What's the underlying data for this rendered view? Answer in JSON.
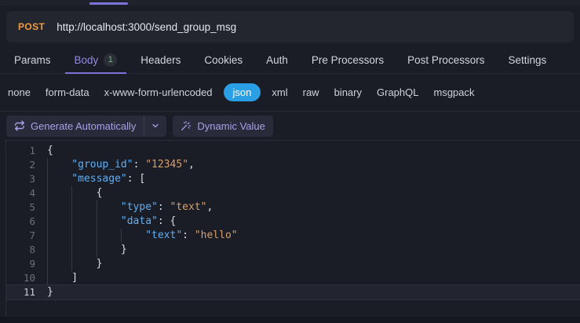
{
  "window": {
    "top_tab_indicator_color": "#7c73da"
  },
  "request_bar": {
    "method": "POST",
    "url": "http://localhost:3000/send_group_msg",
    "method_color": "#ef9b40"
  },
  "tabs": [
    {
      "label": "Params"
    },
    {
      "label": "Body",
      "badge": "1",
      "active": true
    },
    {
      "label": "Headers"
    },
    {
      "label": "Cookies"
    },
    {
      "label": "Auth"
    },
    {
      "label": "Pre Processors"
    },
    {
      "label": "Post Processors"
    },
    {
      "label": "Settings"
    }
  ],
  "body_types": [
    {
      "label": "none"
    },
    {
      "label": "form-data"
    },
    {
      "label": "x-www-form-urlencoded"
    },
    {
      "label": "json",
      "active": true
    },
    {
      "label": "xml"
    },
    {
      "label": "raw"
    },
    {
      "label": "binary"
    },
    {
      "label": "GraphQL"
    },
    {
      "label": "msgpack"
    }
  ],
  "toolbar": {
    "generate_label": "Generate Automatically",
    "generate_icon": "repeat-icon",
    "generate_dropdown_icon": "chevron-down-icon",
    "dynamic_label": "Dynamic Value",
    "dynamic_icon": "magic-wand-icon",
    "accent_color": "#2b9fe6",
    "button_text_color": "#a6a0e8"
  },
  "editor": {
    "active_line": 11,
    "syntax_colors": {
      "key": "#61aef2",
      "string": "#d89f6e",
      "punctuation": "#dadde4"
    },
    "lines": [
      {
        "num": "1",
        "guides": 0,
        "tokens": [
          {
            "t": "punc",
            "v": "{"
          }
        ]
      },
      {
        "num": "2",
        "guides": 1,
        "tokens": [
          {
            "t": "key",
            "v": "\"group_id\""
          },
          {
            "t": "punc",
            "v": ": "
          },
          {
            "t": "str",
            "v": "\"12345\""
          },
          {
            "t": "punc",
            "v": ","
          }
        ]
      },
      {
        "num": "3",
        "guides": 1,
        "tokens": [
          {
            "t": "key",
            "v": "\"message\""
          },
          {
            "t": "punc",
            "v": ": ["
          }
        ]
      },
      {
        "num": "4",
        "guides": 2,
        "tokens": [
          {
            "t": "punc",
            "v": "{"
          }
        ]
      },
      {
        "num": "5",
        "guides": 3,
        "tokens": [
          {
            "t": "key",
            "v": "\"type\""
          },
          {
            "t": "punc",
            "v": ": "
          },
          {
            "t": "str",
            "v": "\"text\""
          },
          {
            "t": "punc",
            "v": ","
          }
        ]
      },
      {
        "num": "6",
        "guides": 3,
        "tokens": [
          {
            "t": "key",
            "v": "\"data\""
          },
          {
            "t": "punc",
            "v": ": {"
          }
        ]
      },
      {
        "num": "7",
        "guides": 4,
        "tokens": [
          {
            "t": "key",
            "v": "\"text\""
          },
          {
            "t": "punc",
            "v": ": "
          },
          {
            "t": "str",
            "v": "\"hello\""
          }
        ]
      },
      {
        "num": "8",
        "guides": 3,
        "tokens": [
          {
            "t": "punc",
            "v": "}"
          }
        ]
      },
      {
        "num": "9",
        "guides": 2,
        "tokens": [
          {
            "t": "punc",
            "v": "}"
          }
        ]
      },
      {
        "num": "10",
        "guides": 1,
        "tokens": [
          {
            "t": "punc",
            "v": "]"
          }
        ]
      },
      {
        "num": "11",
        "guides": 0,
        "tokens": [
          {
            "t": "punc",
            "v": "}"
          }
        ]
      }
    ]
  }
}
